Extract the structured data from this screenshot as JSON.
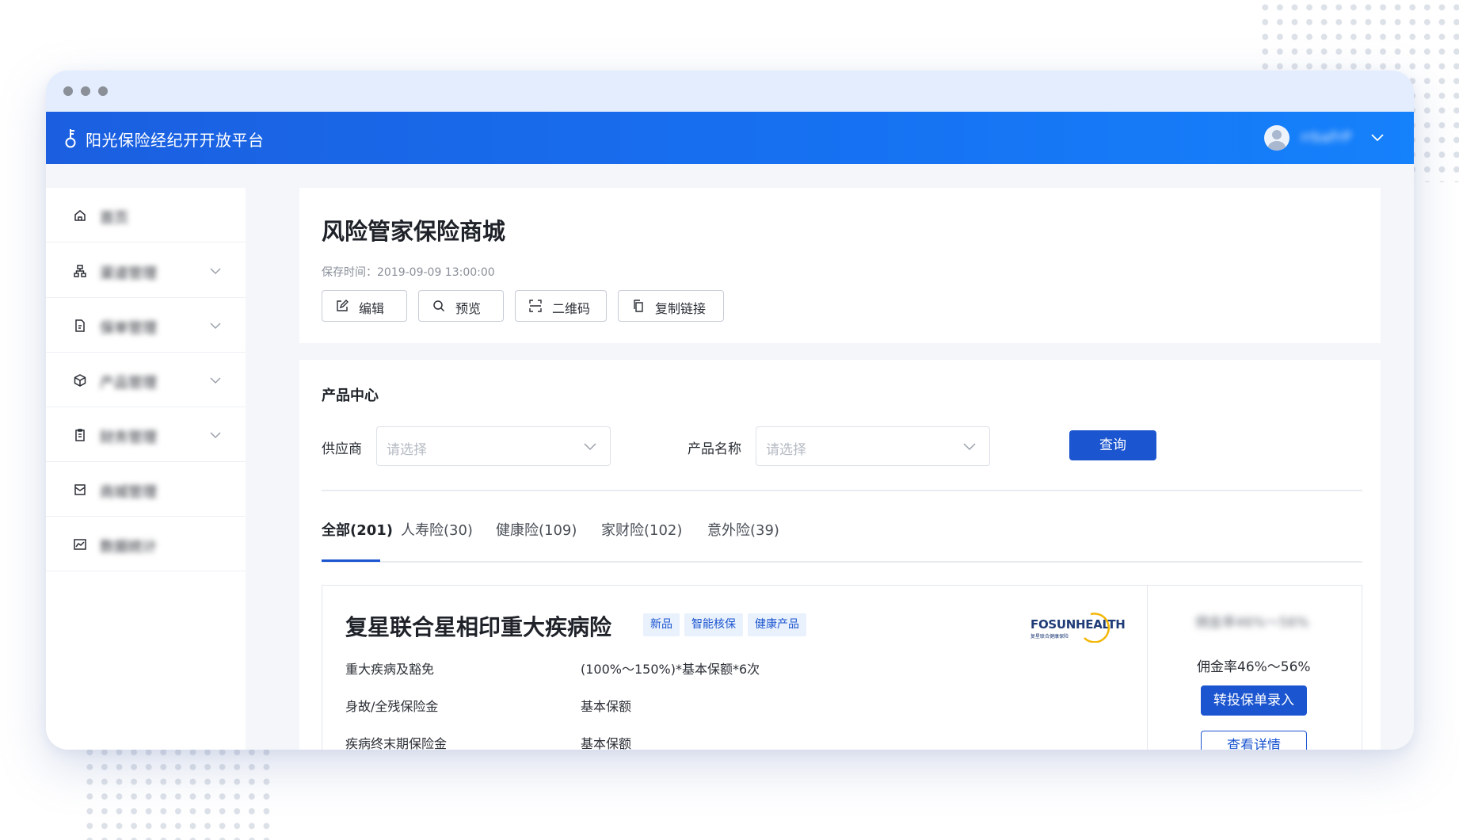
{
  "app": {
    "title": "阳光保险经纪开开放平台",
    "user_name": "rrbaFrP"
  },
  "sidebar": {
    "items": [
      {
        "label": "首页",
        "icon": "home-icon",
        "expandable": false
      },
      {
        "label": "渠道管理",
        "icon": "org-chart-icon",
        "expandable": true
      },
      {
        "label": "保单管理",
        "icon": "document-icon",
        "expandable": true
      },
      {
        "label": "产品管理",
        "icon": "box-icon",
        "expandable": true
      },
      {
        "label": "财务管理",
        "icon": "clipboard-icon",
        "expandable": true
      },
      {
        "label": "商城管理",
        "icon": "mail-icon",
        "expandable": false
      },
      {
        "label": "数据统计",
        "icon": "chart-icon",
        "expandable": false
      }
    ]
  },
  "header": {
    "title": "风险管家保险商城",
    "save_time": "保存时间：2019-09-09 13:00:00",
    "buttons": [
      {
        "label": "编辑",
        "icon": "edit-icon"
      },
      {
        "label": "预览",
        "icon": "search-icon"
      },
      {
        "label": "二维码",
        "icon": "scan-icon"
      },
      {
        "label": "复制链接",
        "icon": "copy-icon"
      }
    ]
  },
  "product_center": {
    "title": "产品中心",
    "supplier_label": "供应商",
    "supplier_placeholder": "请选择",
    "product_label": "产品名称",
    "product_placeholder": "请选择",
    "query_label": "查询",
    "tabs": [
      "全部(201)",
      "人寿险(30)",
      "健康险(109)",
      "家财险(102)",
      "意外险(39)"
    ],
    "active_tab": 0
  },
  "product": {
    "name": "复星联合星相印重大疾病险",
    "tags": [
      "新品",
      "智能核保",
      "健康产品"
    ],
    "brand": "FOSUNHEALTH",
    "brand_sub": "复星联合健康保险",
    "features": [
      {
        "name": "重大疾病及豁免",
        "value": "(100%～150%)*基本保额*6次"
      },
      {
        "name": "身故/全残保险金",
        "value": "基本保额"
      },
      {
        "name": "疾病终末期保险金",
        "value": "基本保额"
      }
    ],
    "rate_blurred": "佣金率46%～56%",
    "rate": "佣金率46%～56%",
    "primary_action": "转投保单录入",
    "secondary_action": "查看详情"
  },
  "colors": {
    "brand_blue": "#1b55cf",
    "header_gradient_start": "#1b5fe0",
    "header_gradient_end": "#1581fb",
    "tag_bg": "#e9f1fd"
  }
}
